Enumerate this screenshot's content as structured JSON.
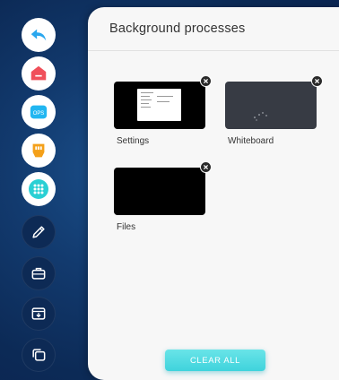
{
  "dock": {
    "items": [
      {
        "name": "back",
        "icon": "back-arrow-icon",
        "color": "#2aa7ee"
      },
      {
        "name": "home",
        "icon": "home-icon",
        "color": "#f04f5a"
      },
      {
        "name": "ops",
        "icon": "ops-icon",
        "label": "OPS",
        "color": "#21b6f1"
      },
      {
        "name": "hdmi",
        "icon": "hdmi-icon",
        "color": "#f4a019"
      },
      {
        "name": "apps",
        "icon": "apps-grid-icon",
        "color": "#2ad0d4"
      },
      {
        "name": "pen",
        "icon": "pen-icon"
      },
      {
        "name": "toolbox",
        "icon": "toolbox-icon"
      },
      {
        "name": "input-source",
        "icon": "input-source-icon"
      },
      {
        "name": "windows",
        "icon": "windows-icon"
      }
    ]
  },
  "panel": {
    "title": "Background processes",
    "tasks": [
      {
        "label": "Settings",
        "thumbnail": "settings-preview"
      },
      {
        "label": "Whiteboard",
        "thumbnail": "whiteboard-preview"
      },
      {
        "label": "Files",
        "thumbnail": "files-preview"
      }
    ],
    "clear_label": "CLEAR ALL"
  },
  "colors": {
    "background": "#0f3264",
    "panel": "#f7f7f7",
    "accent": "#4fdbe2"
  }
}
